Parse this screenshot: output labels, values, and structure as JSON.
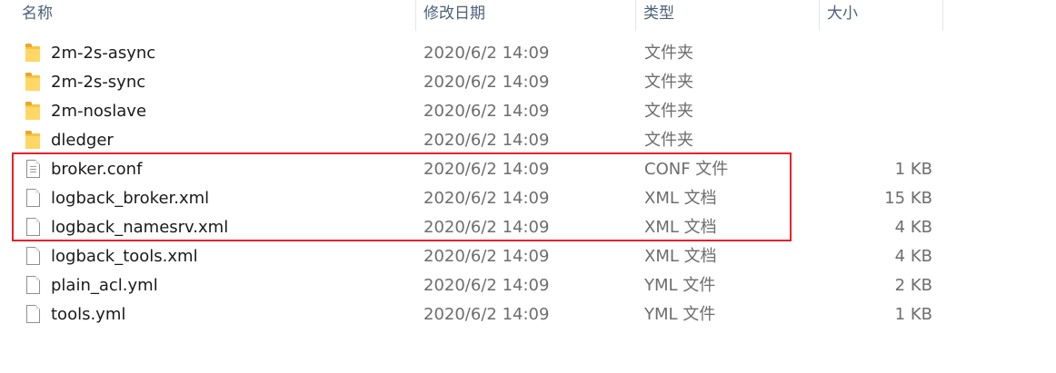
{
  "columns": {
    "name": "名称",
    "date": "修改日期",
    "type": "类型",
    "size": "大小"
  },
  "files": [
    {
      "name": "2m-2s-async",
      "date": "2020/6/2 14:09",
      "type": "文件夹",
      "size": "",
      "icon": "folder-icon"
    },
    {
      "name": "2m-2s-sync",
      "date": "2020/6/2 14:09",
      "type": "文件夹",
      "size": "",
      "icon": "folder-icon"
    },
    {
      "name": "2m-noslave",
      "date": "2020/6/2 14:09",
      "type": "文件夹",
      "size": "",
      "icon": "folder-icon"
    },
    {
      "name": "dledger",
      "date": "2020/6/2 14:09",
      "type": "文件夹",
      "size": "",
      "icon": "folder-icon"
    },
    {
      "name": "broker.conf",
      "date": "2020/6/2 14:09",
      "type": "CONF 文件",
      "size": "1 KB",
      "icon": "conf-file-icon"
    },
    {
      "name": "logback_broker.xml",
      "date": "2020/6/2 14:09",
      "type": "XML 文档",
      "size": "15 KB",
      "icon": "file-icon"
    },
    {
      "name": "logback_namesrv.xml",
      "date": "2020/6/2 14:09",
      "type": "XML 文档",
      "size": "4 KB",
      "icon": "file-icon"
    },
    {
      "name": "logback_tools.xml",
      "date": "2020/6/2 14:09",
      "type": "XML 文档",
      "size": "4 KB",
      "icon": "file-icon"
    },
    {
      "name": "plain_acl.yml",
      "date": "2020/6/2 14:09",
      "type": "YML 文件",
      "size": "2 KB",
      "icon": "file-icon"
    },
    {
      "name": "tools.yml",
      "date": "2020/6/2 14:09",
      "type": "YML 文件",
      "size": "1 KB",
      "icon": "file-icon"
    }
  ],
  "highlight_color": "#e8212b"
}
